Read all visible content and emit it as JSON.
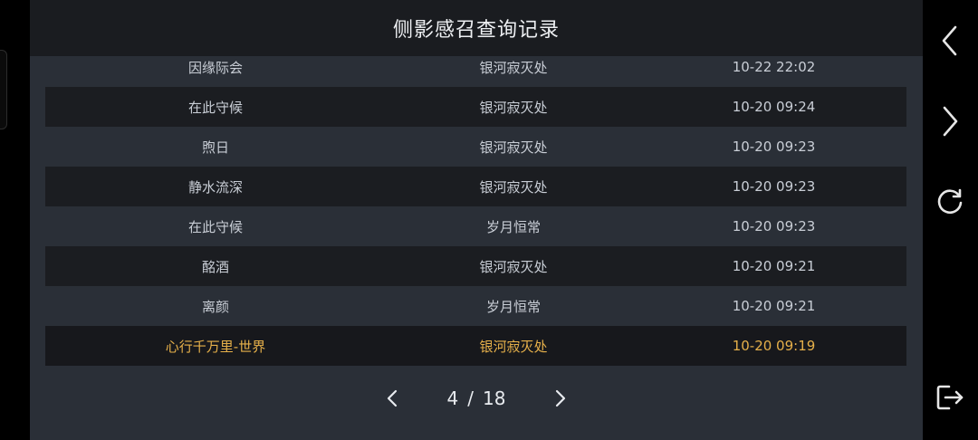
{
  "header": {
    "title": "侧影感召查询记录"
  },
  "records": [
    {
      "name": "因缘际会",
      "location": "银河寂灭处",
      "time": "10-22 22:02"
    },
    {
      "name": "在此守候",
      "location": "银河寂灭处",
      "time": "10-20 09:24"
    },
    {
      "name": "煦日",
      "location": "银河寂灭处",
      "time": "10-20 09:23"
    },
    {
      "name": "静水流深",
      "location": "银河寂灭处",
      "time": "10-20 09:23"
    },
    {
      "name": "在此守候",
      "location": "岁月恒常",
      "time": "10-20 09:23"
    },
    {
      "name": "酩酒",
      "location": "银河寂灭处",
      "time": "10-20 09:21"
    },
    {
      "name": "离颜",
      "location": "岁月恒常",
      "time": "10-20 09:21"
    },
    {
      "name": "心行千万里-世界",
      "location": "银河寂灭处",
      "time": "10-20 09:19"
    }
  ],
  "pagination": {
    "current": "4",
    "separator": "/",
    "total": "18"
  },
  "colors": {
    "highlight": "#e6b04a",
    "panel": "#2a2f37",
    "row_dark": "#1b1d21"
  },
  "side_icons": [
    "back-icon",
    "forward-icon",
    "refresh-icon",
    "exit-icon"
  ]
}
